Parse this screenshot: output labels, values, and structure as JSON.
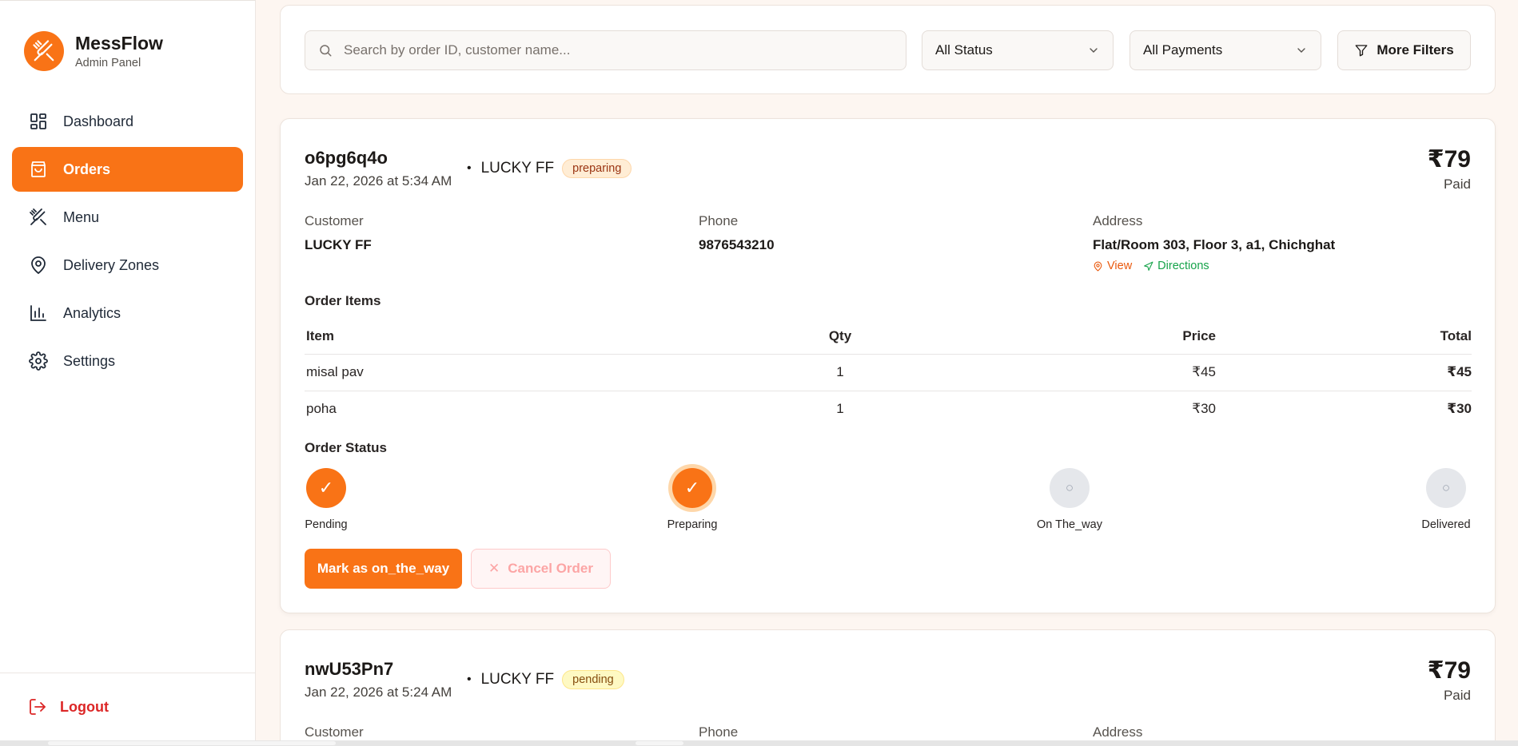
{
  "app": {
    "name": "MessFlow",
    "subtitle": "Admin Panel"
  },
  "sidebar": {
    "items": [
      {
        "label": "Dashboard",
        "icon": "dashboard-icon",
        "active": false
      },
      {
        "label": "Orders",
        "icon": "shopping-bag-icon",
        "active": true
      },
      {
        "label": "Menu",
        "icon": "utensils-icon",
        "active": false
      },
      {
        "label": "Delivery Zones",
        "icon": "map-pin-icon",
        "active": false
      },
      {
        "label": "Analytics",
        "icon": "bar-chart-icon",
        "active": false
      },
      {
        "label": "Settings",
        "icon": "gear-icon",
        "active": false
      }
    ],
    "logout_label": "Logout"
  },
  "filters": {
    "search_placeholder": "Search by order ID, customer name...",
    "status_value": "All Status",
    "payment_value": "All Payments",
    "more_filters_label": "More Filters"
  },
  "orders": [
    {
      "id": "o6pg6q4o",
      "date": "Jan 22, 2026 at 5:34 AM",
      "separator": "•",
      "customer_header": "LUCKY FF",
      "status_badge": "preparing",
      "amount": "₹79",
      "payment_status": "Paid",
      "customer_label": "Customer",
      "customer_name": "LUCKY FF",
      "phone_label": "Phone",
      "phone": "9876543210",
      "address_label": "Address",
      "address": "Flat/Room 303, Floor 3, a1, Chichghat",
      "view_label": "View",
      "directions_label": "Directions",
      "items_title": "Order Items",
      "items_columns": [
        "Item",
        "Qty",
        "Price",
        "Total"
      ],
      "items": [
        {
          "name": "misal pav",
          "qty": "1",
          "price": "₹45",
          "total": "₹45"
        },
        {
          "name": "poha",
          "qty": "1",
          "price": "₹30",
          "total": "₹30"
        }
      ],
      "status_title": "Order Status",
      "steps": [
        {
          "label": "Pending",
          "state": "done",
          "glyph": "✓"
        },
        {
          "label": "Preparing",
          "state": "current",
          "glyph": "✓"
        },
        {
          "label": "On The_way",
          "state": "todo",
          "glyph": "○"
        },
        {
          "label": "Delivered",
          "state": "todo",
          "glyph": "○"
        }
      ],
      "primary_action": "Mark as on_the_way",
      "cancel_action": "Cancel Order",
      "cancel_glyph": "✕"
    },
    {
      "id": "nwU53Pn7",
      "date": "Jan 22, 2026 at 5:24 AM",
      "separator": "•",
      "customer_header": "LUCKY FF",
      "status_badge": "pending",
      "amount": "₹79",
      "payment_status": "Paid",
      "customer_label": "Customer",
      "phone_label": "Phone",
      "address_label": "Address"
    }
  ],
  "colors": {
    "accent": "#f97316",
    "background": "#fdf6f1",
    "logout": "#dc2626",
    "directions": "#16a34a"
  }
}
